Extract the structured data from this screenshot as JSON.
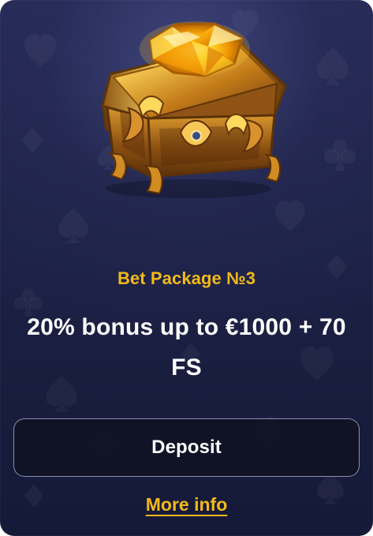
{
  "card": {
    "accent_color": "#f1b91b",
    "background_color": "#1f2349",
    "hero_image": "treasure-chest-icon",
    "package_title": "Bet Package №3",
    "bonus_text": "20% bonus up to €1000 + 70 FS",
    "deposit_label": "Deposit",
    "more_info_label": "More info"
  }
}
